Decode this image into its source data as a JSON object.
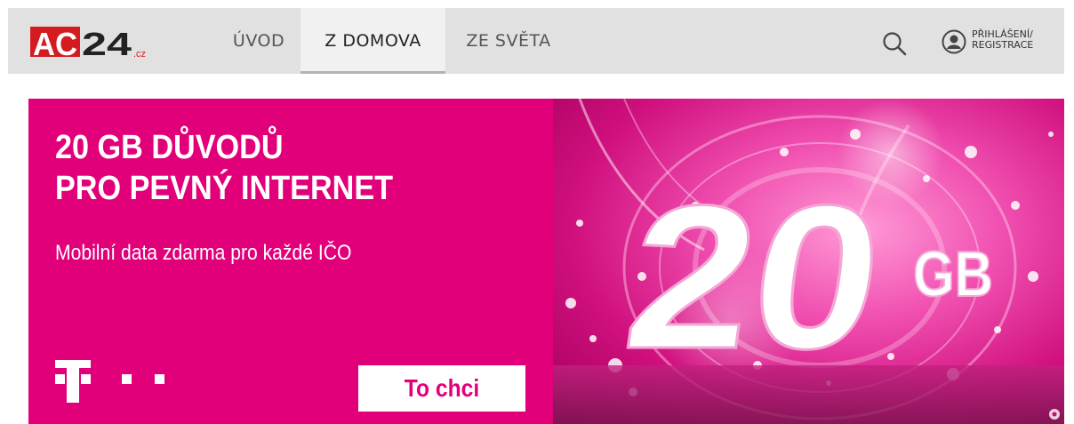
{
  "logo": {
    "text_main": "AC24",
    "text_suffix": ".cz"
  },
  "nav": {
    "items": [
      {
        "label": "ÚVOD"
      },
      {
        "label": "Z DOMOVA",
        "active": true
      },
      {
        "label": "ZE SVĚTA"
      }
    ],
    "search_icon": "search-icon",
    "user_icon": "user-circle-icon",
    "login_line1": "PŘIHLÁŠENÍ/",
    "login_line2": "REGISTRACE"
  },
  "ad": {
    "headline_line1": "20 GB DŮVODŮ",
    "headline_line2": "PRO PEVNÝ INTERNET",
    "subtitle": "Mobilní data zdarma pro každé IČO",
    "cta_label": "To chci",
    "big_number": "20",
    "unit": "GB",
    "brand_logo": "telekom-t-logo",
    "colors": {
      "magenta": "#e2007a",
      "nav_bg": "#e1e1e1"
    }
  }
}
